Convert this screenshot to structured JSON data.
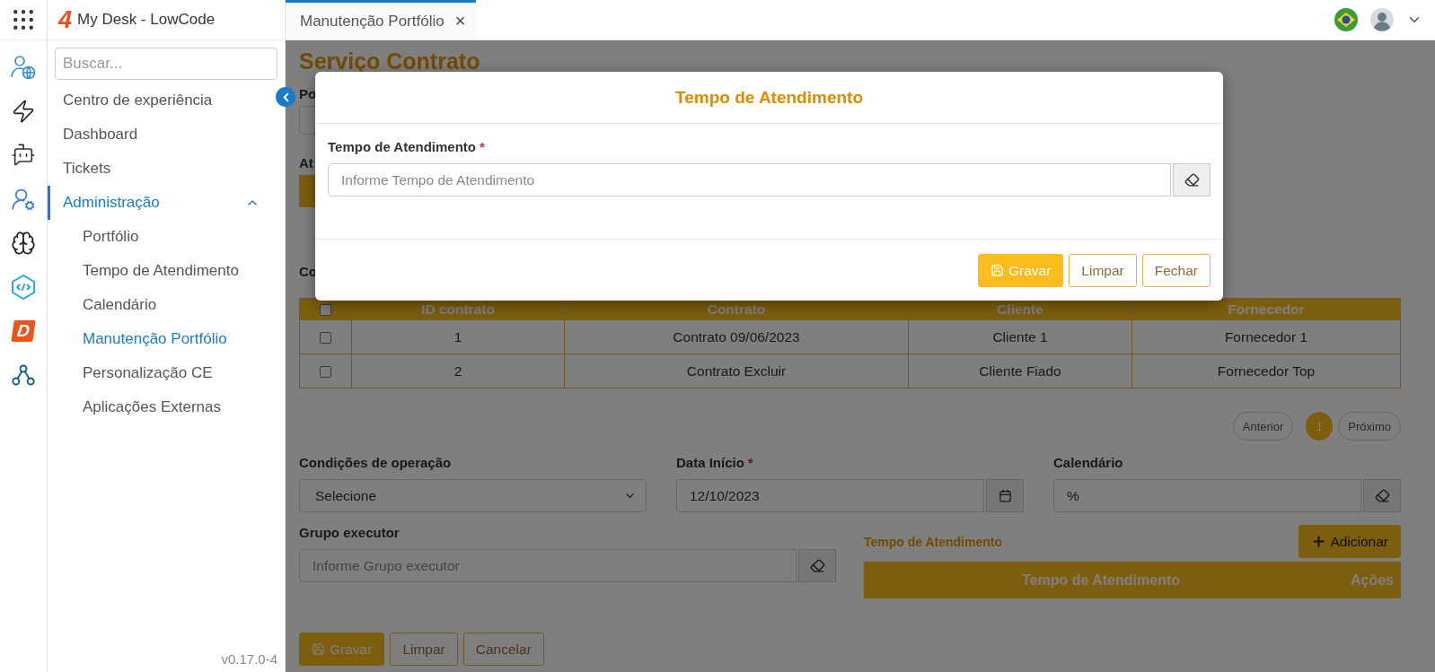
{
  "rail": {
    "badge_letter": "D"
  },
  "app": {
    "logo": "4",
    "title": "My Desk - LowCode"
  },
  "sidebar": {
    "search_placeholder": "Buscar...",
    "items": [
      {
        "label": "Centro de experiência",
        "selected": false
      },
      {
        "label": "Dashboard",
        "selected": false
      },
      {
        "label": "Tickets",
        "selected": false
      },
      {
        "label": "Administração",
        "selected": true,
        "expanded": true,
        "children": [
          {
            "label": "Portfólio",
            "selected": false
          },
          {
            "label": "Tempo de Atendimento",
            "selected": false
          },
          {
            "label": "Calendário",
            "selected": false
          },
          {
            "label": "Manutenção Portfólio",
            "selected": true
          },
          {
            "label": "Personalização CE",
            "selected": false
          },
          {
            "label": "Aplicações Externas",
            "selected": false
          }
        ]
      }
    ],
    "version": "v0.17.0-4"
  },
  "tabs": [
    {
      "label": "Manutenção Portfólio",
      "selected": true,
      "close": "×"
    }
  ],
  "page": {
    "title": "Serviço Contrato",
    "partial_labels": [
      "Po",
      "At",
      "Co"
    ],
    "contracts_table": {
      "header_checked": false,
      "columns": [
        "ID contrato",
        "Contrato",
        "Cliente",
        "Fornecedor"
      ],
      "rows": [
        {
          "checked": false,
          "cells": [
            "1",
            "Contrato 09/06/2023",
            "Cliente 1",
            "Fornecedor 1"
          ]
        },
        {
          "checked": false,
          "cells": [
            "2",
            "Contrato Excluir",
            "Cliente Fiado",
            "Fornecedor Top"
          ]
        }
      ]
    },
    "pagination": {
      "previous": "Anterior",
      "pages": [
        {
          "label": "1",
          "selected": true
        }
      ],
      "next": "Próximo"
    },
    "fields": [
      {
        "kind": "select",
        "label": "Condições de operação",
        "value": "Selecione"
      },
      {
        "kind": "date",
        "label": "Data Início",
        "required_mark": "*",
        "value": "12/10/2023"
      },
      {
        "kind": "clearable",
        "label": "Calendário",
        "value": "%"
      },
      {
        "kind": "clearable",
        "label": "Grupo executor",
        "placeholder": "Informe Grupo executor"
      }
    ],
    "times_table": {
      "title": "Tempo de Atendimento",
      "add_button": "Adicionar",
      "columns": [
        "Tempo de Atendimento",
        "Ações"
      ]
    },
    "buttons": [
      {
        "label": "Gravar",
        "kind": "primary"
      },
      {
        "label": "Limpar",
        "kind": "outline"
      },
      {
        "label": "Cancelar",
        "kind": "outline"
      }
    ]
  },
  "modal": {
    "title": "Tempo de Atendimento",
    "field": {
      "label": "Tempo de Atendimento",
      "required_mark": "*",
      "placeholder": "Informe Tempo de Atendimento"
    },
    "buttons": [
      {
        "label": "Gravar",
        "kind": "primary"
      },
      {
        "label": "Limpar",
        "kind": "outline"
      },
      {
        "label": "Fechar",
        "kind": "outline"
      }
    ]
  }
}
